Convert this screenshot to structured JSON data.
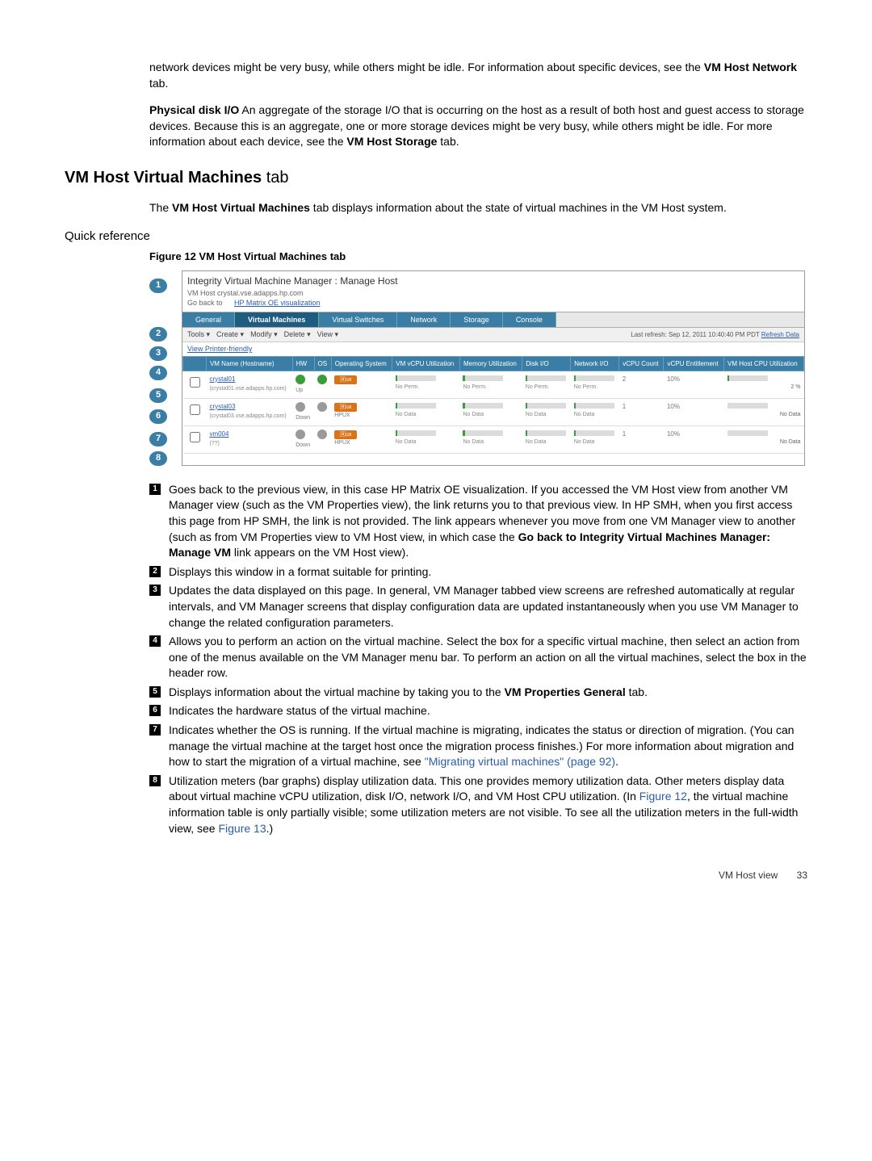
{
  "intro": {
    "para1": "network devices might be very busy, while others might be idle. For information about specific devices, see the ",
    "para1_bold": "VM Host Network",
    "para1_tail": " tab.",
    "para2_lead": "Physical disk I/O",
    "para2_body": " An aggregate of the storage I/O that is occurring on the host as a result of both host and guest access to storage devices. Because this is an aggregate, one or more storage devices might be very busy, while others might be idle. For more information about each device, see the ",
    "para2_bold": "VM Host Storage",
    "para2_tail": " tab."
  },
  "heading": {
    "bold": "VM Host Virtual Machines",
    "thin": " tab"
  },
  "section_intro": {
    "pre": "The ",
    "b": "VM Host Virtual Machines",
    "post": " tab displays information about the state of virtual machines in the VM Host system."
  },
  "quickref": "Quick reference",
  "fig_caption": "Figure 12 VM Host Virtual Machines tab",
  "screenshot": {
    "title": "Integrity Virtual Machine Manager : Manage Host",
    "sub": "VM Host crystal.vse.adapps.hp.com",
    "go_back_pre": "Go back to ",
    "go_back_link": "HP Matrix OE visualization",
    "tabs": [
      "General",
      "Virtual Machines",
      "Virtual Switches",
      "Network",
      "Storage",
      "Console"
    ],
    "toolbar": [
      "Tools ▾",
      "Create ▾",
      "Modify ▾",
      "Delete ▾",
      "View ▾"
    ],
    "pf": "View Printer-friendly",
    "refresh_pre": "Last refresh: ",
    "refresh_ts": "Sep 12, 2011 10:40:40 PM PDT ",
    "refresh_link": "Refresh Data",
    "headers": [
      "",
      "VM Name (Hostname)",
      "HW",
      "OS",
      "Operating System",
      "VM vCPU Utilization",
      "Memory Utilization",
      "Disk I/O",
      "Network I/O",
      "vCPU Count",
      "vCPU Entitlement",
      "VM Host CPU Utilization"
    ],
    "rows": [
      {
        "name": "crystal01",
        "host": "(crystal01.vse.adapps.hp.com)",
        "hw": "green",
        "hw_label": "Up",
        "os_pill": "ux",
        "os_text": "",
        "vals": [
          "No Perm.",
          "No Perm.",
          "No Perm.",
          "No Perm."
        ],
        "vcpu_count": "2",
        "ent": "10%",
        "hostcpu": "2 %"
      },
      {
        "name": "crystal03",
        "host": "(crystal03.vse.adapps.hp.com)",
        "hw": "gray",
        "hw_label": "Down",
        "os_pill": "ux",
        "os_text": "HPUX",
        "vals": [
          "No Data",
          "No Data",
          "No Data",
          "No Data"
        ],
        "vcpu_count": "1",
        "ent": "10%",
        "hostcpu": "No Data"
      },
      {
        "name": "vm004",
        "host": "(??)",
        "hw": "gray",
        "hw_label": "Down",
        "os_pill": "ux",
        "os_text": "HPUX",
        "vals": [
          "No Data",
          "No Data",
          "No Data",
          "No Data"
        ],
        "vcpu_count": "1",
        "ent": "10%",
        "hostcpu": "No Data"
      }
    ]
  },
  "callout_ids": [
    "1",
    "2",
    "3",
    "4",
    "5",
    "6",
    "7",
    "8"
  ],
  "list": {
    "1": {
      "t1": "Goes back to the previous view, in this case HP Matrix OE visualization. If you accessed the VM Host view from another VM Manager view (such as the VM Properties view), the link returns you to that previous view. In HP SMH, when you first access this page from HP SMH, the link is not provided. The link appears whenever you move from one VM Manager view to another (such as from VM Properties view to VM Host view, in which case the ",
      "b": "Go back to Integrity Virtual Machines Manager: Manage VM",
      "t2": " link appears on the VM Host view)."
    },
    "2": "Displays this window in a format suitable for printing.",
    "3": "Updates the data displayed on this page. In general, VM Manager tabbed view screens are refreshed automatically at regular intervals, and VM Manager screens that display configuration data are updated instantaneously when you use VM Manager to change the related configuration parameters.",
    "4": "Allows you to perform an action on the virtual machine. Select the box for a specific virtual machine, then select an action from one of the menus available on the VM Manager menu bar. To perform an action on all the virtual machines, select the box in the header row.",
    "5": {
      "t1": "Displays information about the virtual machine by taking you to the ",
      "b": "VM Properties General",
      "t2": " tab."
    },
    "6": "Indicates the hardware status of the virtual machine.",
    "7": {
      "t1": "Indicates whether the OS is running. If the virtual machine is migrating, indicates the status or direction of migration. (You can manage the virtual machine at the target host once the migration process finishes.) For more information about migration and how to start the migration of a virtual machine, see ",
      "link": "\"Migrating virtual machines\" (page 92)",
      "t2": "."
    },
    "8": {
      "t1": "Utilization meters (bar graphs) display utilization data. This one provides memory utilization data. Other meters display data about virtual machine vCPU utilization, disk I/O, network I/O, and VM Host CPU utilization. (In ",
      "link1": "Figure 12",
      "t2": ", the virtual machine information table is only partially visible; some utilization meters are not visible. To see all the utilization meters in the full-width view, see ",
      "link2": "Figure 13",
      "t3": ".)"
    }
  },
  "footer": {
    "label": "VM Host view",
    "page": "33"
  }
}
